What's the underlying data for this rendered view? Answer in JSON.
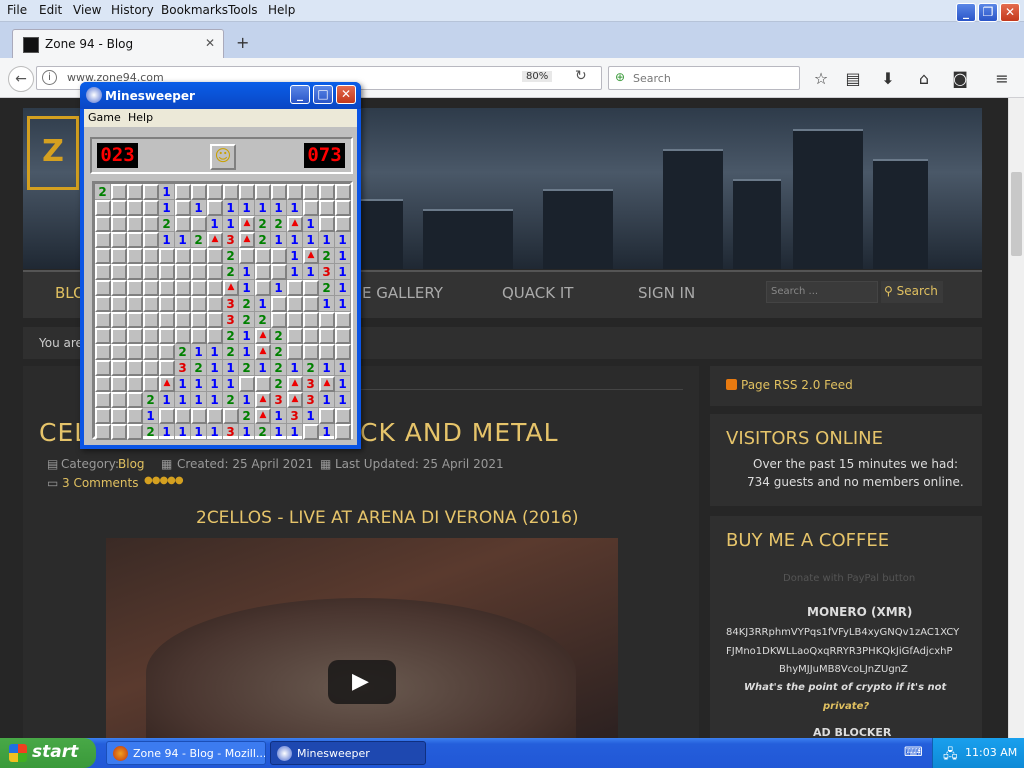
{
  "firefox": {
    "menu": [
      "File",
      "Edit",
      "View",
      "History",
      "Bookmarks",
      "Tools",
      "Help"
    ],
    "tab_title": "Zone 94 - Blog",
    "url": "www.zone94.com",
    "zoom": "80%",
    "search_placeholder": "Search"
  },
  "site": {
    "logo_fragment": "Z",
    "nav": [
      "BLO",
      "E GALLERY",
      "QUACK IT",
      "SIGN IN"
    ],
    "search_placeholder": "Search ...",
    "search_button": "Search",
    "breadcrumb": "You are",
    "article": {
      "title_left": "CEL",
      "title_right": "CK AND METAL",
      "category_label": "Category:",
      "category": "Blog",
      "created": "Created: 25 April 2021",
      "updated": "Last Updated: 25 April 2021",
      "comments": "3 Comments",
      "video_title": "2CELLOS - LIVE AT ARENA DI VERONA (2016)"
    },
    "sidebar": {
      "rss": "Page RSS 2.0 Feed",
      "visitors_heading": "VISITORS ONLINE",
      "visitors_text_1": "Over the past 15 minutes we had:",
      "visitors_text_2": "734 guests and no members online.",
      "coffee_heading": "BUY ME A COFFEE",
      "paypal": "Donate with PayPal button",
      "monero_heading": "MONERO (XMR)",
      "monero_addr_1": "84KJ3RRphmVYPqs1fVFyLB4xyGNQv1zAC1XCY",
      "monero_addr_2": "FJMno1DKWLLaoQxqRRYR3PHKQkJiGfAdjcxhP",
      "monero_addr_3": "BhyMJJuMB8VcoLJnZUgnZ",
      "crypto_q_1": "What's the point of crypto if it's not",
      "crypto_q_2": "private?",
      "adblock": "AD BLOCKER"
    }
  },
  "minesweeper": {
    "title": "Minesweeper",
    "menu": [
      "Game",
      "Help"
    ],
    "mines_left": "023",
    "timer": "073",
    "face": "☺",
    "grid": [
      "2...1...........",
      "....1.1.11111...",
      "....2..11F22F1..",
      "....112F3F211111",
      "........2...1F21",
      "........21..1131",
      "........F1.1..21",
      "........321...11",
      "........322.....",
      "........21F2....",
      ".....21121F2....",
      ".....321121212111",
      "....F1111..2F3F1",
      "...2111121F3F311",
      "...1.....2F131..",
      "...2111131211.1."
    ]
  },
  "taskbar": {
    "start": "start",
    "tasks": [
      "Zone 94 - Blog - Mozill...",
      "Minesweeper"
    ],
    "time": "11:03 AM"
  }
}
